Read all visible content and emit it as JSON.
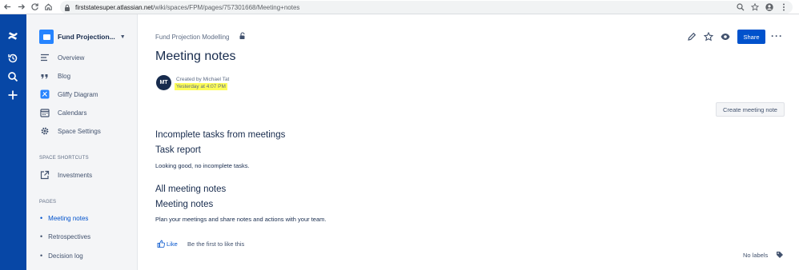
{
  "browser": {
    "url_host": "firststatesuper.atlassian.net",
    "url_path": "/wiki/spaces/FPM/pages/757301668/Meeting+notes"
  },
  "sidebar": {
    "space_name": "Fund Projection...",
    "items": [
      {
        "label": "Overview",
        "icon": "overview-icon"
      },
      {
        "label": "Blog",
        "icon": "blog-quote-icon"
      },
      {
        "label": "Gliffy Diagram",
        "icon": "gliffy-icon"
      },
      {
        "label": "Calendars",
        "icon": "calendar-icon"
      },
      {
        "label": "Space Settings",
        "icon": "gear-icon"
      }
    ],
    "shortcuts_label": "SPACE SHORTCUTS",
    "shortcuts": [
      {
        "label": "Investments",
        "icon": "external-link-icon"
      }
    ],
    "pages_label": "PAGES",
    "pages": [
      {
        "label": "Meeting notes",
        "active": true
      },
      {
        "label": "Retrospectives",
        "active": false
      },
      {
        "label": "Decision log",
        "active": false
      }
    ]
  },
  "main": {
    "breadcrumb": "Fund Projection Modelling",
    "title": "Meeting notes",
    "author_initials": "MT",
    "created_by": "Created by Michael Tat",
    "created_at": "Yesterday at 4:07 PM",
    "create_button": "Create meeting note",
    "share_button": "Share",
    "sections": [
      {
        "heading": "Incomplete tasks from meetings"
      },
      {
        "heading": "Task report",
        "text": "Looking good, no incomplete tasks."
      },
      {
        "heading": "All meeting notes"
      },
      {
        "heading": "Meeting notes",
        "text": "Plan your meetings and share notes and actions with your team."
      }
    ],
    "like_label": "Like",
    "like_text": "Be the first to like this",
    "labels_text": "No labels"
  },
  "colors": {
    "global_nav": "#0747a6",
    "primary": "#0052cc",
    "highlight": "#fdfd58"
  }
}
